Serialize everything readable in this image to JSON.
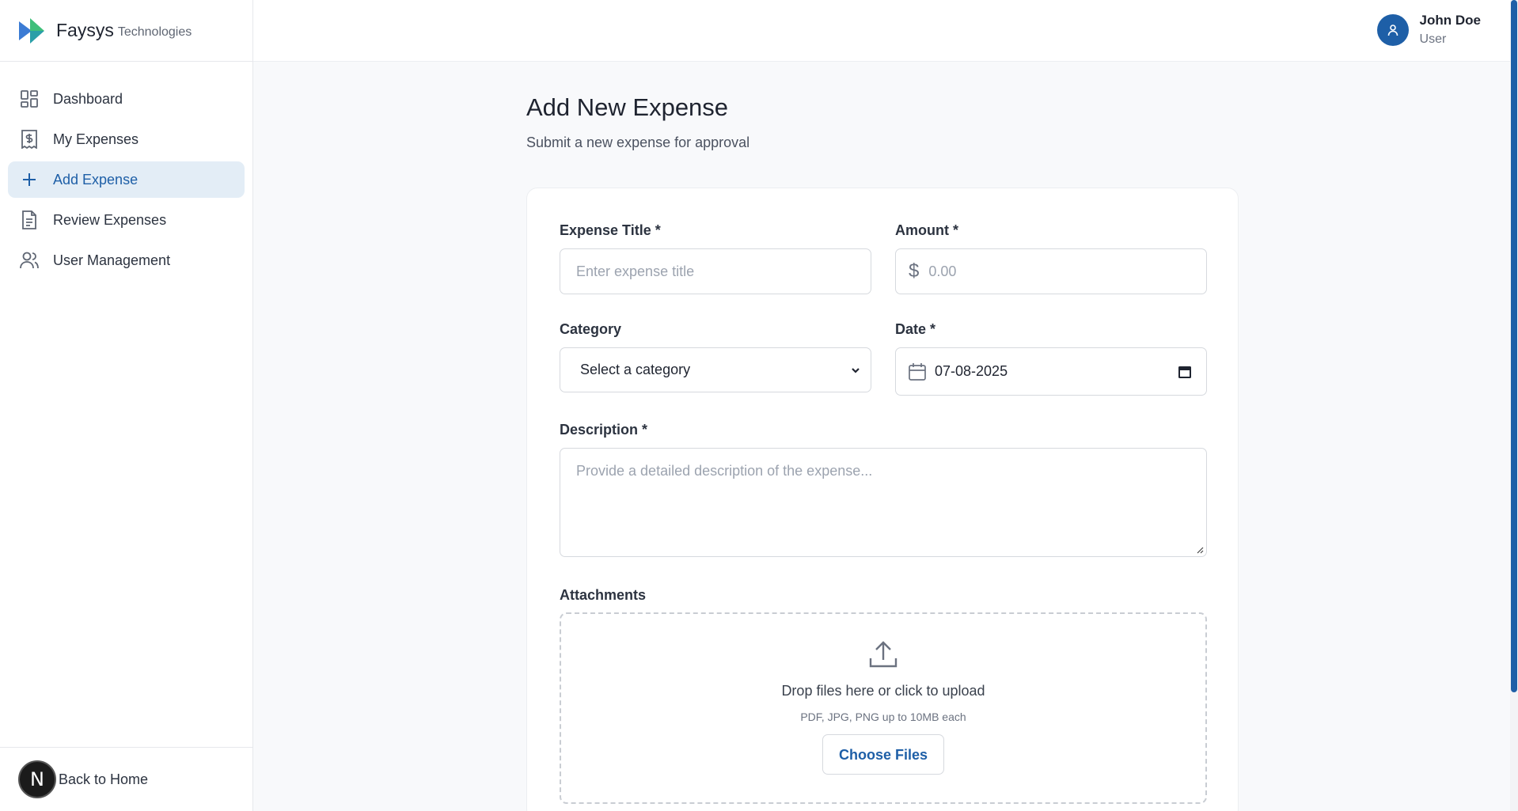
{
  "brand": {
    "name": "Faysys",
    "subtitle": "Technologies"
  },
  "sidebar": {
    "items": [
      {
        "label": "Dashboard",
        "icon": "dashboard-icon"
      },
      {
        "label": "My Expenses",
        "icon": "receipt-dollar-icon"
      },
      {
        "label": "Add Expense",
        "icon": "plus-icon",
        "active": true
      },
      {
        "label": "Review Expenses",
        "icon": "document-icon"
      },
      {
        "label": "User Management",
        "icon": "users-icon"
      }
    ],
    "footer": {
      "badge": "N",
      "label": "Back to Home"
    }
  },
  "header": {
    "user_name": "John Doe",
    "user_role": "User"
  },
  "main": {
    "title": "Add New Expense",
    "subtitle": "Submit a new expense for approval"
  },
  "form": {
    "title_label": "Expense Title *",
    "title_placeholder": "Enter expense title",
    "amount_label": "Amount *",
    "amount_placeholder": "0.00",
    "category_label": "Category",
    "category_value": "Select a category",
    "date_label": "Date *",
    "date_value": "07-08-2025",
    "description_label": "Description *",
    "description_placeholder": "Provide a detailed description of the expense...",
    "attachments_label": "Attachments",
    "upload_title": "Drop files here or click to upload",
    "upload_sub": "PDF, JPG, PNG up to 10MB each",
    "choose_files": "Choose Files"
  },
  "colors": {
    "accent": "#1e5fa7",
    "active_bg": "#e3edf6",
    "background": "#f8f9fb"
  }
}
